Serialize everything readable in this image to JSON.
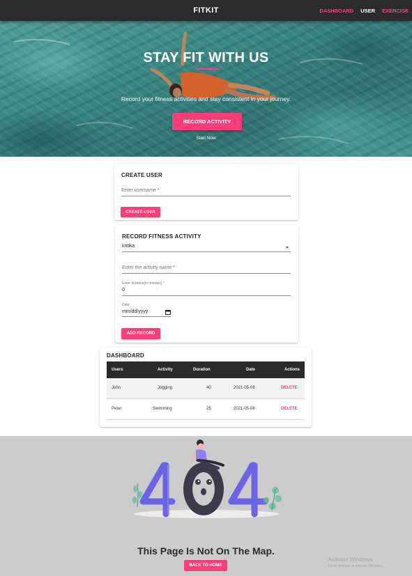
{
  "navbar": {
    "brand": "FITKIT",
    "links": [
      "DASHBOARD",
      "USER",
      "EXERCISE"
    ]
  },
  "hero": {
    "title": "STAY FIT WITH US",
    "subtitle": "Record your fitness activities and stay consistent in your journey.",
    "button_label": "RECORD ACTIVITY",
    "start_label": "Start Now"
  },
  "create_user": {
    "title": "CREATE USER",
    "username_placeholder": "Enter username *",
    "button_label": "CREATE USER"
  },
  "record_activity": {
    "title": "RECORD FITNESS ACTIVITY",
    "selected_user": "kritika",
    "activity_placeholder": "Enter the activity name *",
    "duration_label": "Enter duration(in minutes) *",
    "duration_value": "0",
    "date_label": "Date",
    "date_value": "mm/dd/yyyy",
    "button_label": "ADD RECORD"
  },
  "dashboard": {
    "title": "DASHBOARD",
    "columns": [
      "Users",
      "Activity",
      "Duration",
      "Date",
      "Actions"
    ],
    "rows": [
      {
        "user": "John",
        "activity": "Jogging",
        "duration": "40",
        "date": "2021-05-08",
        "action": "DELETE"
      },
      {
        "user": "Peter",
        "activity": "Swimming",
        "duration": "25",
        "date": "2021-05-08",
        "action": "DELETE"
      }
    ]
  },
  "not_found": {
    "digits": "404",
    "message": "This Page Is Not On The Map.",
    "button_label": "BACK TO HOME"
  },
  "watermark": {
    "line1": "Activate Windows",
    "line2": "Go to Settings to activate Windows."
  },
  "colors": {
    "accent": "#ff3d7a",
    "navbar": "#2b2b2b",
    "digit_purple": "#6b63e6",
    "not_found_bg": "#cccccc"
  }
}
